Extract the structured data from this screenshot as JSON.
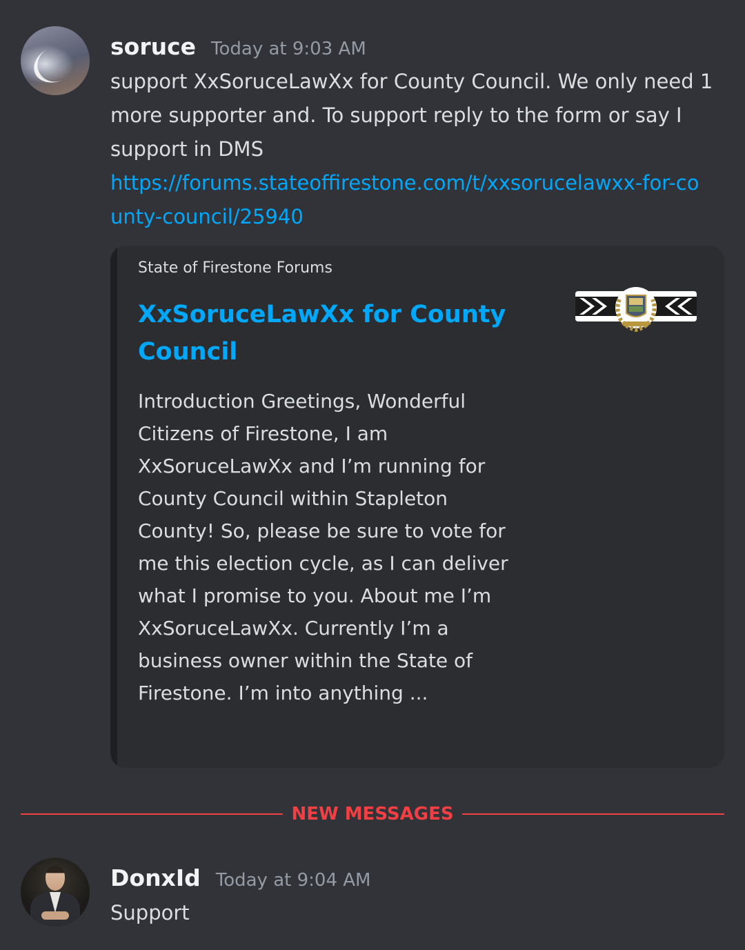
{
  "messages": [
    {
      "username": "soruce",
      "timestamp": "Today at 9:03 AM",
      "text": "support XxSoruceLawXx for County Council. We only  need 1 more supporter and. To support reply to the form or say I support in DMS",
      "link": "https://forums.stateoffirestone.com/t/xxsorucelawxx-for-county-council/25940",
      "embed": {
        "provider": "State of Firestone Forums",
        "title": "XxSoruceLawXx for County Council",
        "description": "Introduction   Greetings, Wonderful Citizens of Firestone, I am XxSoruceLawXx and I’m running for County Council within   Stapleton County! So, please be sure to vote for me this election cycle, as I can deliver what I promise to you.   About me   I’m XxSoruceLawXx. Currently I’m a business owner within the State of Firestone. I’m into anything ...",
        "thumbnail_icon": "state-of-firestone-logo-icon"
      }
    },
    {
      "username": "DonxId",
      "timestamp": "Today at 9:04 AM",
      "text": "Support"
    }
  ],
  "divider": {
    "label": "NEW MESSAGES"
  },
  "colors": {
    "background": "#313338",
    "embed_background": "#2b2d31",
    "link": "#00a8fc",
    "new_messages": "#f23f43",
    "username": "#f2f3f5",
    "timestamp": "#949ba4"
  }
}
